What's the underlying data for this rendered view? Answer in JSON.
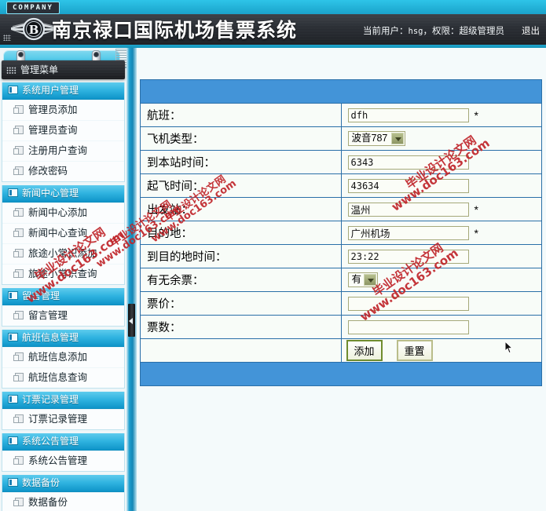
{
  "topbar": {
    "company_badge": "COMPANY"
  },
  "header": {
    "title": "南京禄口国际机场售票系统",
    "logo_icon": "winged-b-emblem",
    "current_user_text": "当前用户：",
    "username": "hsg",
    "role_text": "，权限：超级管理员",
    "logout_label": "退出"
  },
  "sidebar": {
    "menu_title": "管理菜单",
    "groups": [
      {
        "title": "系统用户管理",
        "items": [
          "管理员添加",
          "管理员查询",
          "注册用户查询",
          "修改密码"
        ]
      },
      {
        "title": "新闻中心管理",
        "items": [
          "新闻中心添加",
          "新闻中心查询",
          "旅途小常识添加",
          "旅途小常识查询"
        ]
      },
      {
        "title": "留言管理",
        "items": [
          "留言管理"
        ]
      },
      {
        "title": "航班信息管理",
        "items": [
          "航班信息添加",
          "航班信息查询"
        ]
      },
      {
        "title": "订票记录管理",
        "items": [
          "订票记录管理"
        ]
      },
      {
        "title": "系统公告管理",
        "items": [
          "系统公告管理"
        ]
      },
      {
        "title": "数据备份",
        "items": [
          "数据备份"
        ]
      }
    ]
  },
  "form": {
    "rows": [
      {
        "label": "航班：",
        "type": "text",
        "value": "dfh",
        "required": "*"
      },
      {
        "label": "飞机类型：",
        "type": "select",
        "value": "波音787",
        "required": ""
      },
      {
        "label": "到本站时间：",
        "type": "text",
        "value": "6343",
        "required": ""
      },
      {
        "label": "起飞时间：",
        "type": "text",
        "value": "43634",
        "required": ""
      },
      {
        "label": "出发站：",
        "type": "text",
        "value": "温州",
        "required": "*"
      },
      {
        "label": "目的地：",
        "type": "text",
        "value": "广州机场",
        "required": "*"
      },
      {
        "label": "到目的地时间：",
        "type": "text",
        "value": "23:22",
        "required": ""
      },
      {
        "label": "有无余票：",
        "type": "select",
        "value": "有",
        "required": ""
      },
      {
        "label": "票价：",
        "type": "text",
        "value": "",
        "required": ""
      },
      {
        "label": "票数：",
        "type": "text",
        "value": "",
        "required": ""
      }
    ],
    "submit_label": "添加",
    "reset_label": "重置"
  },
  "watermarks": {
    "line1": "毕业设计论文网",
    "line2": "www.doc163.com"
  },
  "colors": {
    "accent_blue": "#1ea7cf",
    "header_dark": "#272b31",
    "form_bar_blue": "#4394d8",
    "input_border": "#a6a97a",
    "watermark_red": "#c0252a"
  }
}
